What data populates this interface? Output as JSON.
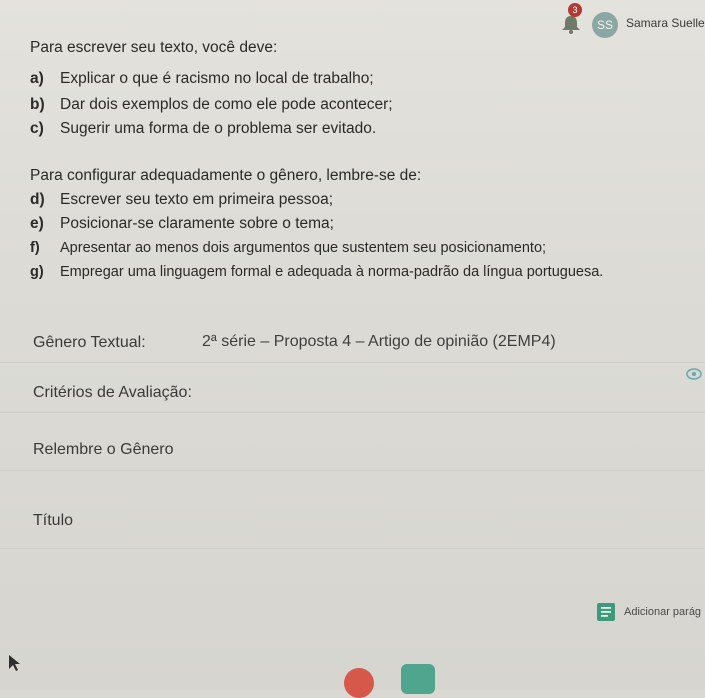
{
  "header": {
    "notification_count": "3",
    "avatar_initials": "SS",
    "user_name": "Samara Suelle"
  },
  "instructions": {
    "intro_1": "Para escrever seu texto, você deve:",
    "items_1": [
      {
        "letter": "a)",
        "text": "Explicar o que é racismo no local de trabalho;"
      },
      {
        "letter": "b)",
        "text": "Dar dois exemplos de como ele pode acontecer;"
      },
      {
        "letter": "c)",
        "text": "Sugerir uma forma de o problema ser evitado."
      }
    ],
    "intro_2": "Para configurar adequadamente o gênero, lembre-se de:",
    "items_2": [
      {
        "letter": "d)",
        "text": "Escrever seu texto em primeira pessoa;"
      },
      {
        "letter": "e)",
        "text": "Posicionar-se claramente sobre o tema;"
      },
      {
        "letter": "f)",
        "text": "Apresentar ao menos dois argumentos que sustentem seu posicionamento;"
      },
      {
        "letter": "g)",
        "text": "Empregar uma linguagem formal e adequada à norma-padrão da língua portuguesa."
      }
    ]
  },
  "form": {
    "genre_label": "Gênero Textual:",
    "genre_value": "2ª série – Proposta 4 – Artigo de opinião (2EMP4)",
    "criteria_label": "Critérios de Avaliação:",
    "recall_label": "Relembre o Gênero",
    "title_label": "Título",
    "add_paragraph_label": "Adicionar parág"
  },
  "icons": {
    "bell": "bell-icon",
    "eye": "eye-icon",
    "add_paragraph": "add-paragraph-icon"
  },
  "colors": {
    "background": "#dcdbd5",
    "avatar": "#8aa7a3",
    "badge": "#b03a36",
    "add_paragraph_icon": "#3f9a7b"
  }
}
